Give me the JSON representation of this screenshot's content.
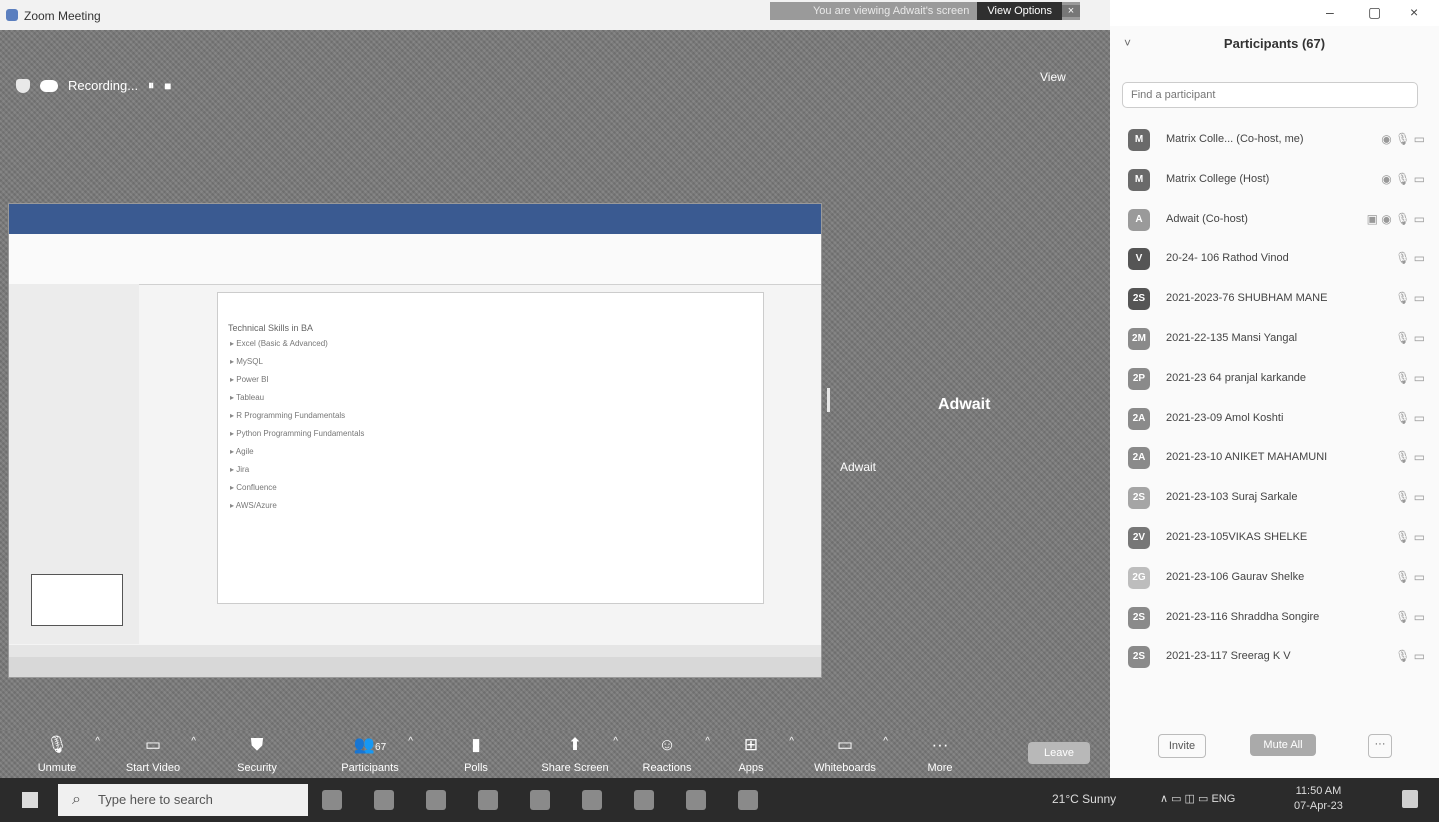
{
  "window": {
    "title": "Zoom Meeting"
  },
  "banner": {
    "text": "You are viewing Adwait's screen",
    "view_options": "View Options",
    "close": "×"
  },
  "top_bar": {
    "recording_label": "Recording...",
    "pause": "⏸",
    "stop": "■",
    "view_label": "View"
  },
  "shared_screen": {
    "slide_title": "Technical Skills in BA",
    "bullets": [
      "Excel (Basic & Advanced)",
      "MySQL",
      "Power BI",
      "Tableau",
      "R Programming Fundamentals",
      "Python Programming Fundamentals",
      "Agile",
      "Jira",
      "Confluence",
      "AWS/Azure"
    ]
  },
  "stage": {
    "speaker_name": "Adwait",
    "tile_name": "Adwait"
  },
  "toolbar": {
    "unmute": "Unmute",
    "start_video": "Start Video",
    "security": "Security",
    "participants": "Participants",
    "participants_count": "67",
    "polls": "Polls",
    "share_screen": "Share Screen",
    "reactions": "Reactions",
    "apps": "Apps",
    "whiteboards": "Whiteboards",
    "more": "More",
    "leave": "Leave"
  },
  "window_controls": {
    "minimize": "–",
    "maximize": "▢",
    "close": "×"
  },
  "panel": {
    "title": "Participants (67)",
    "search_placeholder": "Find a participant",
    "participants": [
      {
        "initials": "M",
        "name": "Matrix Colle... (Co-host, me)",
        "icons": "◉ 🎙 ▭",
        "color": "#6a6a6a"
      },
      {
        "initials": "M",
        "name": "Matrix College (Host)",
        "icons": "◉ 🎙 ▭",
        "color": "#6a6a6a"
      },
      {
        "initials": "A",
        "name": "Adwait (Co-host)",
        "icons": "▣ ◉ 🎙 ▭",
        "color": "#9a9a9a"
      },
      {
        "initials": "V",
        "name": "20-24- 106 Rathod Vinod",
        "icons": "🎙 ▭",
        "color": "#555555"
      },
      {
        "initials": "2S",
        "name": "2021-2023-76 SHUBHAM MANE",
        "icons": "🎙 ▭",
        "color": "#555555"
      },
      {
        "initials": "2M",
        "name": "2021-22-135 Mansi Yangal",
        "icons": "🎙 ▭",
        "color": "#8a8a8a"
      },
      {
        "initials": "2P",
        "name": "2021-23 64 pranjal karkande",
        "icons": "🎙 ▭",
        "color": "#8a8a8a"
      },
      {
        "initials": "2A",
        "name": "2021-23-09 Amol Koshti",
        "icons": "🎙 ▭",
        "color": "#8a8a8a"
      },
      {
        "initials": "2A",
        "name": "2021-23-10 ANIKET MAHAMUNI",
        "icons": "🎙 ▭",
        "color": "#8a8a8a"
      },
      {
        "initials": "2S",
        "name": "2021-23-103 Suraj Sarkale",
        "icons": "🎙 ▭",
        "color": "#a5a5a5"
      },
      {
        "initials": "2V",
        "name": "2021-23-105VIKAS SHELKE",
        "icons": "🎙 ▭",
        "color": "#777777"
      },
      {
        "initials": "2G",
        "name": "2021-23-106 Gaurav Shelke",
        "icons": "🎙 ▭",
        "color": "#bdbdbd"
      },
      {
        "initials": "2S",
        "name": "2021-23-116 Shraddha Songire",
        "icons": "🎙 ▭",
        "color": "#8a8a8a"
      },
      {
        "initials": "2S",
        "name": "2021-23-117 Sreerag K V",
        "icons": "🎙 ▭",
        "color": "#8a8a8a"
      }
    ],
    "invite": "Invite",
    "mute_all": "Mute All",
    "more": "···"
  },
  "taskbar": {
    "search_placeholder": "Type here to search",
    "weather": "21°C Sunny",
    "tray": "∧ ▭ ◫ ▭ ENG",
    "time": "11:50 AM",
    "date": "07-Apr-23"
  }
}
